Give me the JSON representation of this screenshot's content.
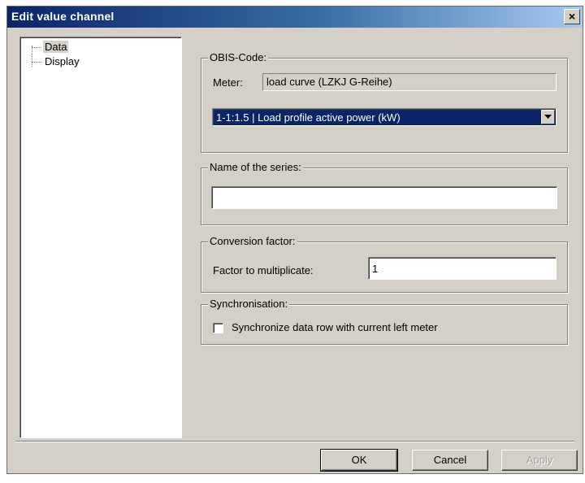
{
  "window": {
    "title": "Edit value channel",
    "close_label": "×"
  },
  "tree": {
    "items": [
      {
        "label": "Data",
        "selected": true
      },
      {
        "label": "Display",
        "selected": false
      }
    ]
  },
  "obis": {
    "group_title": "OBIS-Code:",
    "meter_label": "Meter:",
    "meter_value": "load curve (LZKJ G-Reihe)",
    "selected_code": "1-1:1.5 | Load profile active power (kW)"
  },
  "series": {
    "group_title": "Name of the series:",
    "value": ""
  },
  "conversion": {
    "group_title": "Conversion factor:",
    "factor_label": "Factor to multiplicate:",
    "factor_value": "1"
  },
  "sync": {
    "group_title": "Synchronisation:",
    "checkbox_label": "Synchronize data row with current left meter",
    "checked": false
  },
  "buttons": {
    "ok": "OK",
    "cancel": "Cancel",
    "apply": "Apply"
  },
  "colors": {
    "title_bar": "#0a246a",
    "dialog_bg": "#d4d0c8",
    "selection": "#0a246a"
  }
}
